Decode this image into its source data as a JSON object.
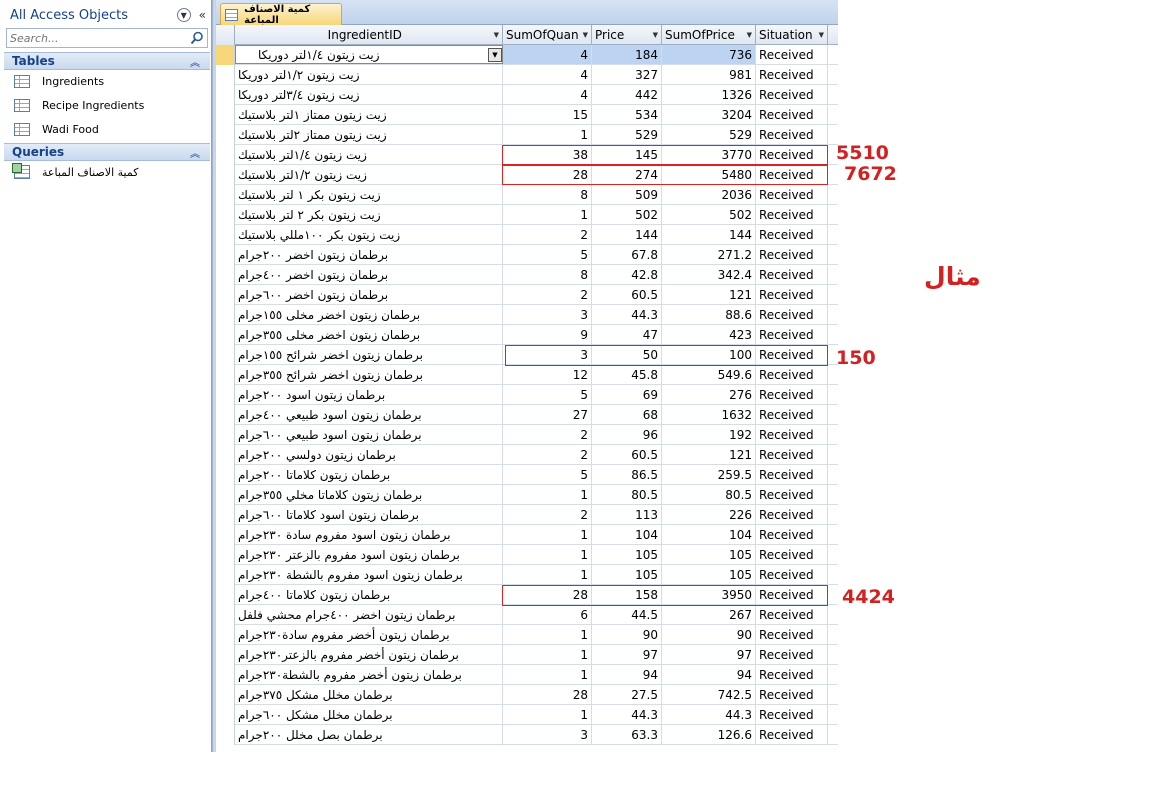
{
  "nav": {
    "title": "All Access Objects",
    "search_placeholder": "Search...",
    "tables_header": "Tables",
    "tables": [
      "Ingredients",
      "Recipe Ingredients",
      "Wadi Food"
    ],
    "queries_header": "Queries",
    "queries": [
      "كمية الاصناف المباعة"
    ]
  },
  "document": {
    "tab_title": "كمية الاصناف المباعة"
  },
  "grid": {
    "columns": [
      "IngredientID",
      "SumOfQuan",
      "Price",
      "SumOfPrice",
      "Situation"
    ],
    "rows": [
      [
        "زيت زيتون ١/٤لتر دوريكا",
        "4",
        "184",
        "736",
        "Received"
      ],
      [
        "زيت زيتون ١/٢لتر دوريكا",
        "4",
        "327",
        "981",
        "Received"
      ],
      [
        "زيت زيتون ٣/٤لتر دوريكا",
        "4",
        "442",
        "1326",
        "Received"
      ],
      [
        "زيت زيتون ممتاز ١لتر بلاستيك",
        "15",
        "534",
        "3204",
        "Received"
      ],
      [
        "زيت زيتون ممتاز ٢لتر بلاستيك",
        "1",
        "529",
        "529",
        "Received"
      ],
      [
        "زيت زيتون ١/٤لتر بلاستيك",
        "38",
        "145",
        "3770",
        "Received"
      ],
      [
        "زيت زيتون ١/٢لتر بلاستيك",
        "28",
        "274",
        "5480",
        "Received"
      ],
      [
        "زيت زيتون بكر ١ لتر بلاستيك",
        "8",
        "509",
        "2036",
        "Received"
      ],
      [
        "زيت زيتون بكر ٢ لتر بلاستيك",
        "1",
        "502",
        "502",
        "Received"
      ],
      [
        "زيت زيتون بكر ١٠٠مللي بلاستيك",
        "2",
        "144",
        "144",
        "Received"
      ],
      [
        "برطمان زيتون اخضر ٢٠٠جرام",
        "5",
        "67.8",
        "271.2",
        "Received"
      ],
      [
        "برطمان زيتون اخضر ٤٠٠جرام",
        "8",
        "42.8",
        "342.4",
        "Received"
      ],
      [
        "برطمان زيتون اخضر ٦٠٠جرام",
        "2",
        "60.5",
        "121",
        "Received"
      ],
      [
        "برطمان زيتون اخضر مخلى ١٥٥جرام",
        "3",
        "44.3",
        "88.6",
        "Received"
      ],
      [
        "برطمان زيتون اخضر مخلى ٣٥٥جرام",
        "9",
        "47",
        "423",
        "Received"
      ],
      [
        "برطمان زيتون اخضر شرائح ١٥٥جرام",
        "3",
        "50",
        "100",
        "Received"
      ],
      [
        "برطمان زيتون اخضر شرائح ٣٥٥جرام",
        "12",
        "45.8",
        "549.6",
        "Received"
      ],
      [
        "برطمان زيتون اسود ٢٠٠جرام",
        "5",
        "69",
        "276",
        "Received"
      ],
      [
        "برطمان زيتون اسود طبيعي ٤٠٠جرام",
        "27",
        "68",
        "1632",
        "Received"
      ],
      [
        "برطمان زيتون اسود طبيعي ٦٠٠جرام",
        "2",
        "96",
        "192",
        "Received"
      ],
      [
        "برطمان زيتون دولسي ٢٠٠جرام",
        "2",
        "60.5",
        "121",
        "Received"
      ],
      [
        "برطمان زيتون كلاماتا ٢٠٠جرام",
        "5",
        "86.5",
        "259.5",
        "Received"
      ],
      [
        "برطمان زيتون كلاماتا مخلي ٣٥٥جرام",
        "1",
        "80.5",
        "80.5",
        "Received"
      ],
      [
        "برطمان زيتون اسود كلاماتا ٦٠٠جرام",
        "2",
        "113",
        "226",
        "Received"
      ],
      [
        "برطمان زيتون اسود مفروم سادة ٢٣٠جرام",
        "1",
        "104",
        "104",
        "Received"
      ],
      [
        "برطمان زيتون اسود مفروم بالزعتر ٢٣٠جرام",
        "1",
        "105",
        "105",
        "Received"
      ],
      [
        "برطمان زيتون اسود مفروم بالشطة ٢٣٠جرام",
        "1",
        "105",
        "105",
        "Received"
      ],
      [
        "برطمان زيتون كلاماتا ٤٠٠جرام",
        "28",
        "158",
        "3950",
        "Received"
      ],
      [
        "برطمان زيتون اخضر ٤٠٠جرام محشي فلفل",
        "6",
        "44.5",
        "267",
        "Received"
      ],
      [
        "برطمان زيتون أخضر مفروم سادة٢٣٠جرام",
        "1",
        "90",
        "90",
        "Received"
      ],
      [
        "برطمان زيتون أخضر مفروم بالزعتر٢٣٠جرام",
        "1",
        "97",
        "97",
        "Received"
      ],
      [
        "برطمان زيتون أخضر مفروم بالشطة٢٣٠جرام",
        "1",
        "94",
        "94",
        "Received"
      ],
      [
        "برطمان مخلل مشكل ٣٧٥جرام",
        "28",
        "27.5",
        "742.5",
        "Received"
      ],
      [
        "برطمان مخلل مشكل ٦٠٠جرام",
        "1",
        "44.3",
        "44.3",
        "Received"
      ],
      [
        "برطمان بصل مخلل ٢٠٠جرام",
        "3",
        "63.3",
        "126.6",
        "Received"
      ]
    ]
  },
  "annotations": {
    "a1": "5510",
    "a2": "7672",
    "a3": "150",
    "a4": "4424",
    "example": "مثال"
  },
  "colors": {
    "annotation": "#d42020",
    "selection": "#bcd4f2",
    "tab": "#f7d67a"
  }
}
